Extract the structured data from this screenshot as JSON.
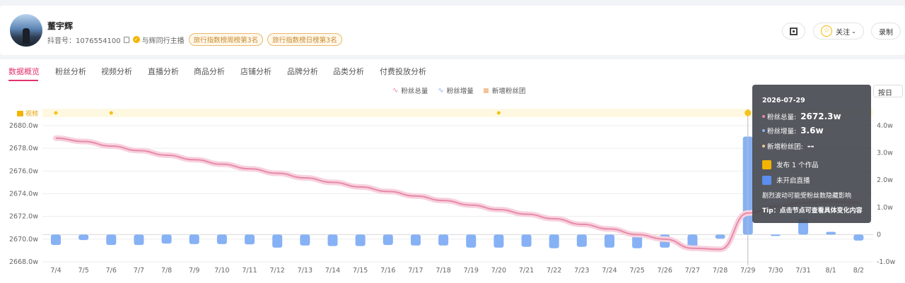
{
  "profile": {
    "name": "董宇辉",
    "id_text": "抖音号：1076554100",
    "relation": "与辉同行主播",
    "tags": [
      "旅行指数榜周榜第3名",
      "旅行指数榜日榜第3名"
    ]
  },
  "actions": {
    "follow_label": "关注",
    "record_label": "录制"
  },
  "tabs": [
    "数据概览",
    "粉丝分析",
    "视频分析",
    "直播分析",
    "商品分析",
    "店铺分析",
    "品牌分析",
    "品类分析",
    "付费投放分析"
  ],
  "active_tab": 0,
  "period": "按日",
  "video_row_label": "视频",
  "colors": {
    "accent": "#e0336e",
    "total_line": "#e88aa6",
    "increase_bar": "#86b1f5",
    "video_dot": "#f3c21b",
    "fan_group": "#f3c39a"
  },
  "chart_data": {
    "type": "line",
    "legend": [
      "粉丝总量",
      "粉丝增量",
      "新增粉丝团"
    ],
    "categories": [
      "7/4",
      "7/5",
      "7/6",
      "7/7",
      "7/8",
      "7/9",
      "7/10",
      "7/11",
      "7/12",
      "7/13",
      "7/14",
      "7/15",
      "7/16",
      "7/17",
      "7/18",
      "7/19",
      "7/20",
      "7/21",
      "7/22",
      "7/23",
      "7/24",
      "7/25",
      "7/26",
      "7/27",
      "7/28",
      "7/29",
      "7/30",
      "7/31",
      "8/1",
      "8/2"
    ],
    "y_left": {
      "ticks": [
        "2668.0w",
        "2670.0w",
        "2672.0w",
        "2674.0w",
        "2676.0w",
        "2678.0w",
        "2680.0w"
      ],
      "ylim": [
        2668.0,
        2680.0
      ]
    },
    "y_right": {
      "ticks": [
        "-1.0w",
        "0",
        "1.0w",
        "2.0w",
        "3.0w",
        "4.0w"
      ],
      "ylim": [
        -1.0,
        4.0
      ]
    },
    "series": [
      {
        "name": "粉丝总量",
        "axis": "left",
        "values": [
          2678.9,
          2678.6,
          2678.2,
          2677.8,
          2677.4,
          2677.0,
          2676.6,
          2676.2,
          2675.8,
          2675.4,
          2675.0,
          2674.6,
          2674.2,
          2673.8,
          2673.4,
          2673.0,
          2672.6,
          2672.2,
          2671.8,
          2671.3,
          2670.9,
          2670.4,
          2670.0,
          2669.2,
          2669.1,
          2672.3,
          2672.9,
          2673.2,
          2673.3,
          2673.2
        ]
      },
      {
        "name": "粉丝增量",
        "axis": "right",
        "values": [
          -0.38,
          -0.2,
          -0.38,
          -0.38,
          -0.33,
          -0.35,
          -0.35,
          -0.36,
          -0.48,
          -0.4,
          -0.42,
          -0.42,
          -0.38,
          -0.4,
          -0.4,
          -0.48,
          -0.48,
          -0.45,
          -0.5,
          -0.45,
          -0.48,
          -0.5,
          -0.48,
          -0.46,
          -0.15,
          3.6,
          -0.05,
          0.58,
          0.1,
          -0.22
        ]
      }
    ],
    "video_days": [
      "7/4",
      "7/6",
      "7/20",
      "7/29"
    ],
    "grid": true
  },
  "tooltip": {
    "date": "2026-07-29",
    "total_label": "粉丝总量:",
    "total_value": "2672.3w",
    "increase_label": "粉丝增量:",
    "increase_value": "3.6w",
    "fan_group_label": "新增粉丝团:",
    "fan_group_value": "--",
    "publish": "发布 1 个作品",
    "live": "未开启直播",
    "note": "剧烈波动可能受粉丝数隐藏影响",
    "tip": "Tip：点击节点可查看具体变化内容"
  }
}
